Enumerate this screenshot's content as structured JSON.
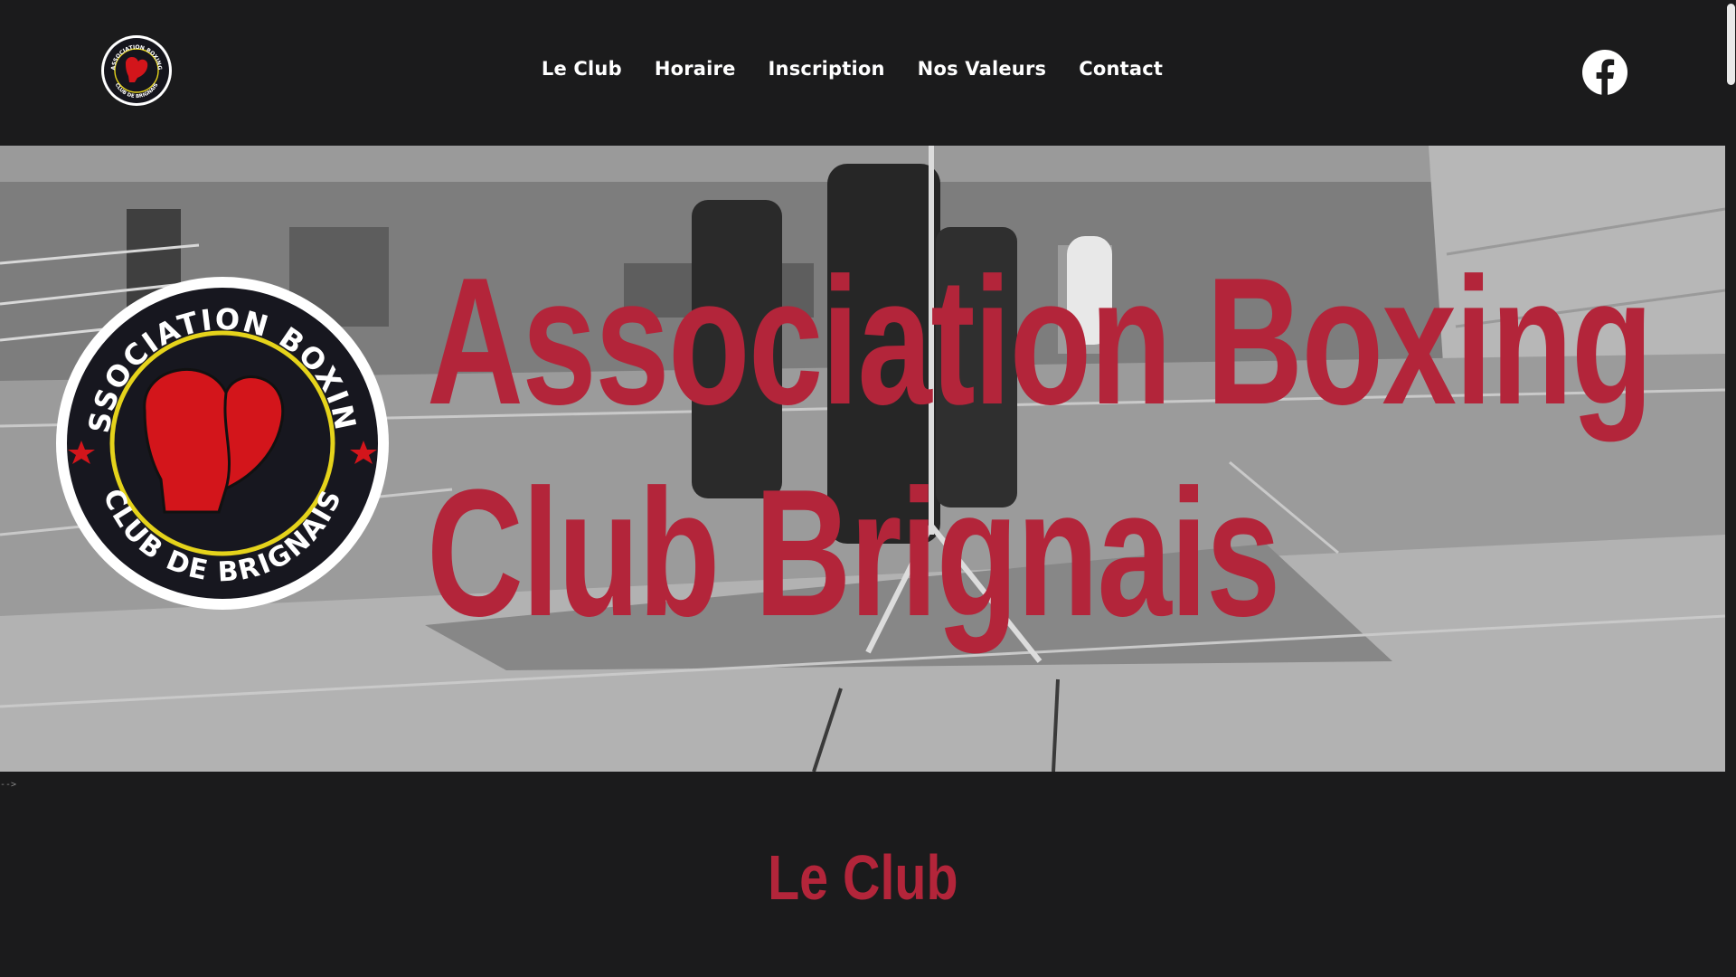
{
  "header": {
    "logo_text_top": "ASSOCIATION BOXING",
    "logo_text_bottom": "CLUB DE BRIGNAIS",
    "nav": [
      "Le Club",
      "Horaire",
      "Inscription",
      "Nos Valeurs",
      "Contact"
    ],
    "social_icon": "facebook-icon"
  },
  "hero": {
    "title_line1": "Association Boxing",
    "title_line2": "Club Brignais",
    "logo_text_top": "ASSOCIATION BOXING",
    "logo_text_bottom": "CLUB DE BRIGNAIS"
  },
  "stray_text": "-->",
  "section": {
    "title": "Le Club"
  },
  "colors": {
    "background": "#1b1b1c",
    "accent_red": "#b3253a",
    "nav_text": "#ffffff"
  }
}
